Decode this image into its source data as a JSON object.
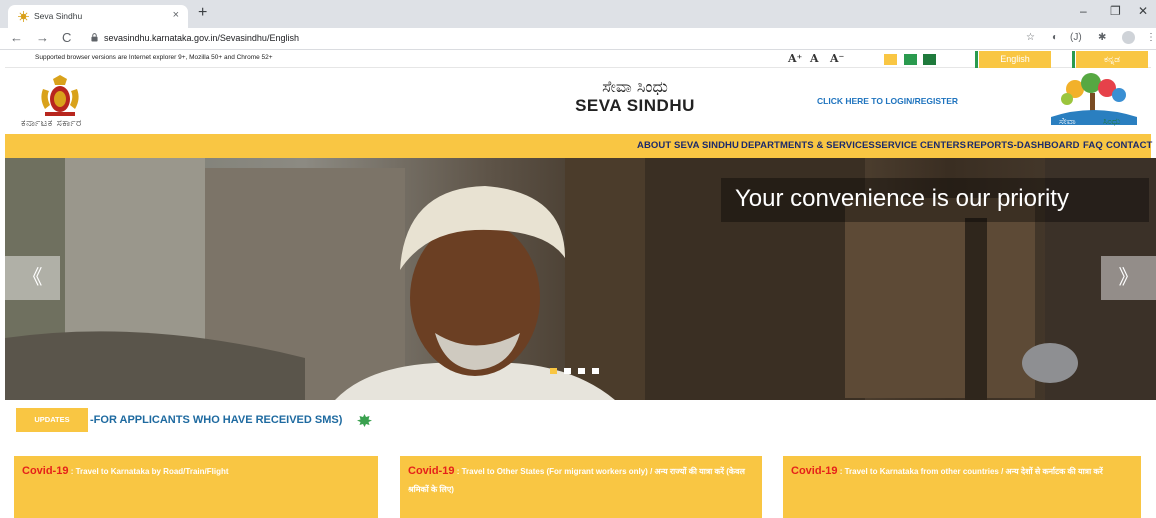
{
  "browser": {
    "tab_title": "Seva Sindhu",
    "tab_close": "×",
    "new_tab": "+",
    "url": "sevasindhu.karnataka.gov.in/Sevasindhu/English",
    "window_controls": [
      "–",
      "❐",
      "✕"
    ],
    "extension_badge": "(J)"
  },
  "site": {
    "support_notice": "Supported browser versions are Internet explorer 9+, Mozilla 50+ and Chrome 52+",
    "font_controls": [
      "A⁺",
      "A",
      "A⁻"
    ],
    "theme_swatches": [
      "#f9c643",
      "#2a9a4e",
      "#1f7a3c"
    ],
    "languages": [
      "English",
      "ಕನ್ನಡ"
    ],
    "govt_label": "ಕರ್ನಾಟಕ ಸರ್ಕಾರ",
    "brand_kannada": "ಸೇವಾ ಸಿಂಧು",
    "brand_english": "SEVA SINDHU",
    "login_link": "CLICK HERE TO LOGIN/REGISTER",
    "logo_text": [
      "ಸೇವಾ",
      "ಸಿಂಧು"
    ]
  },
  "menu": [
    "ABOUT SEVA SINDHU",
    "DEPARTMENTS & SERVICES",
    "SERVICE CENTERS",
    "REPORTS-DASHBOARD",
    "FAQ",
    "CONTACT"
  ],
  "banner": {
    "caption": "Your convenience is our priority",
    "prev_arrow": "《",
    "next_arrow": "》",
    "active_slide": 1,
    "slide_count": 4
  },
  "updates": {
    "label": "UPDATES",
    "text": "-FOR APPLICANTS WHO HAVE RECEIVED SMS)"
  },
  "cards": [
    {
      "lead": "Covid-19",
      "text": " : Travel to Karnataka by Road/Train/Flight"
    },
    {
      "lead": "Covid-19",
      "text": " : Travel to Other States (For migrant workers only) / अन्य राज्यों की यात्रा करें (केवल श्रमिकों के लिए)"
    },
    {
      "lead": "Covid-19",
      "text": " : Travel to Karnataka from other countries / अन्य देशों से कर्नाटक की यात्रा करें"
    }
  ],
  "colors": {
    "accent_yellow": "#f9c643",
    "menu_text": "#1c2a6b",
    "link_blue": "#1e73be",
    "covid_red": "#e5221a"
  }
}
